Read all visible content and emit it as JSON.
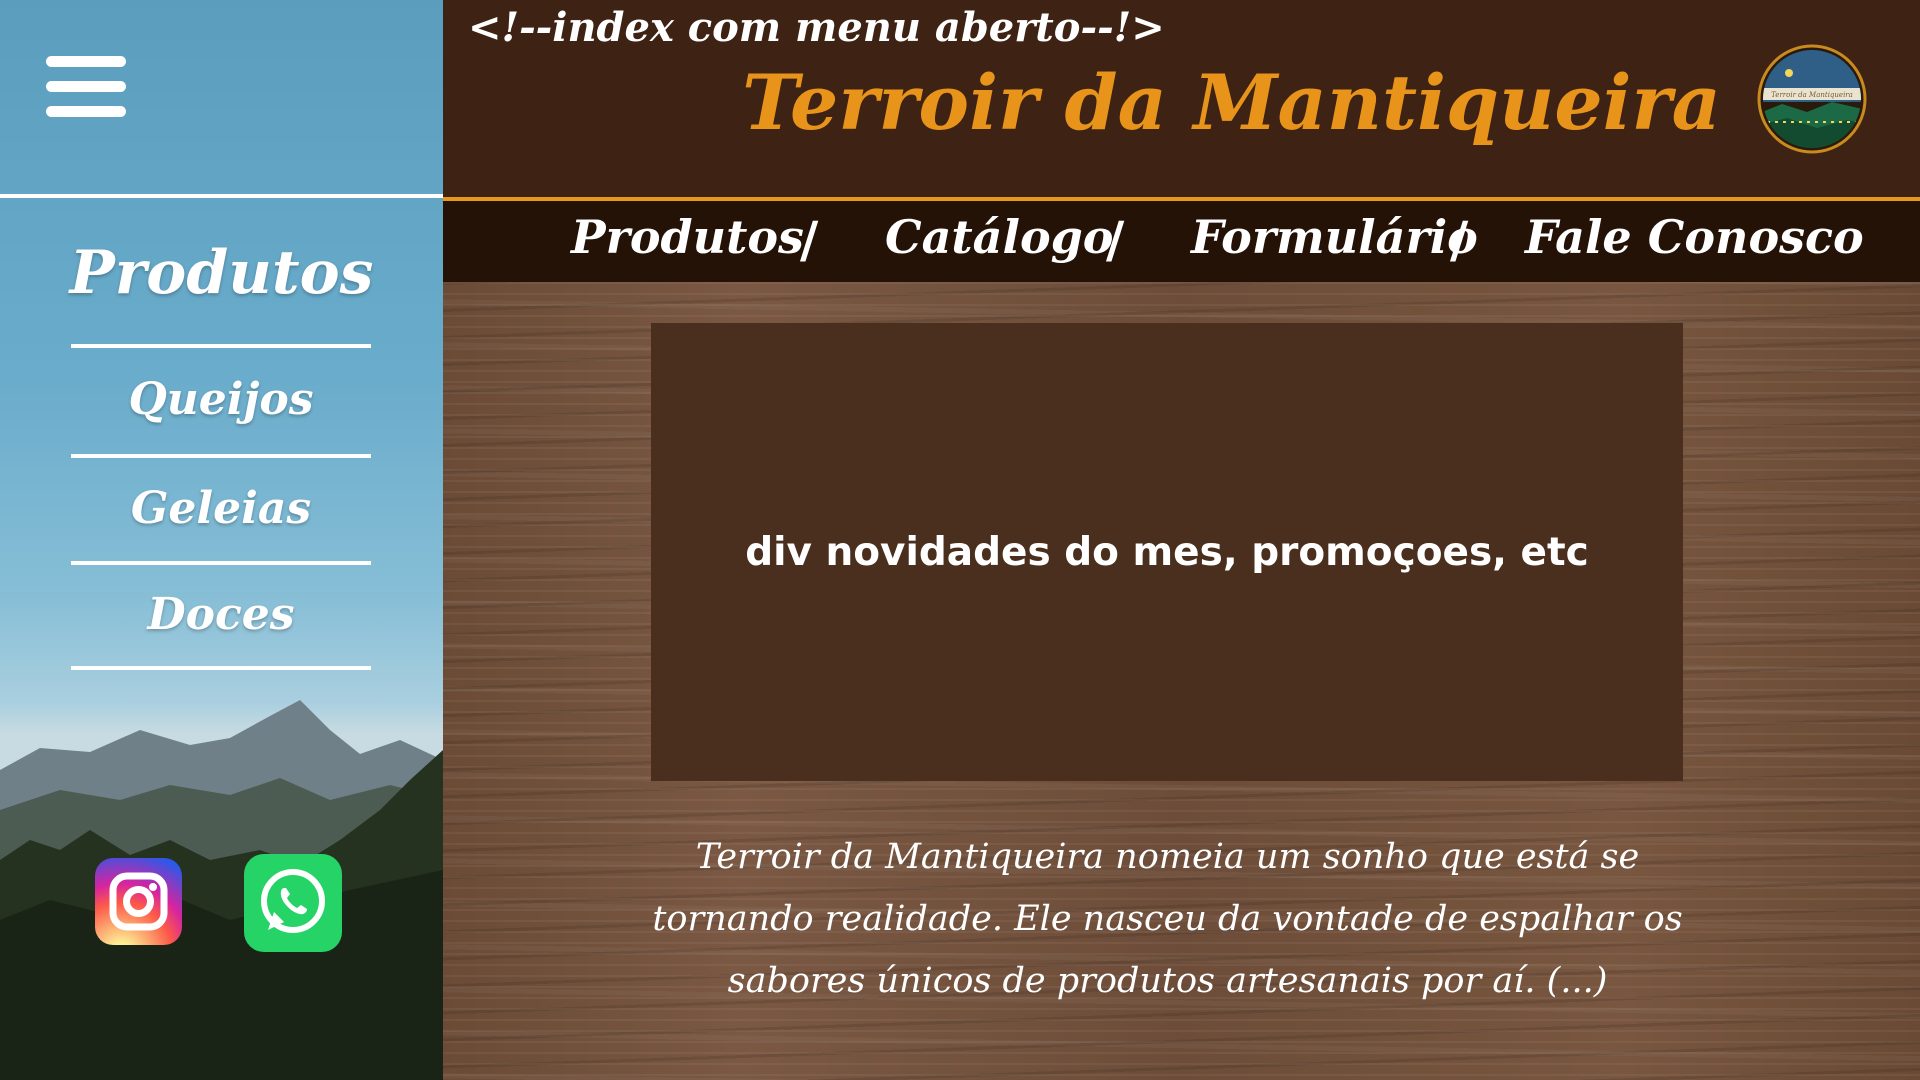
{
  "header": {
    "comment": "<!--index com menu aberto--!>",
    "title": "Terroir da Mantiqueira",
    "logo_text": "Terroir da Mantiqueira"
  },
  "nav": {
    "items": [
      {
        "label": "Produtos"
      },
      {
        "label": "Catálogo"
      },
      {
        "label": "Formulário"
      },
      {
        "label": "Fale Conosco"
      }
    ],
    "separator": "/"
  },
  "sidebar": {
    "title": "Produtos",
    "items": [
      {
        "label": "Queijos"
      },
      {
        "label": "Geleias"
      },
      {
        "label": "Doces"
      }
    ],
    "social": [
      {
        "icon": "instagram-icon"
      },
      {
        "icon": "whatsapp-icon"
      }
    ]
  },
  "main": {
    "promo": "div novidades do mes, promoçoes, etc",
    "about_lines": [
      "Terroir da Mantiqueira nomeia um sonho que está se",
      "tornando realidade. Ele nasceu da vontade de espalhar os",
      "sabores únicos de produtos artesanais por aí. (...)"
    ]
  },
  "colors": {
    "header_bg": "#3e2214",
    "nav_bg": "#241207",
    "accent": "#e69a1c",
    "promo_bg": "#4b2f1e",
    "sidebar_sky": "#6aaccb"
  }
}
